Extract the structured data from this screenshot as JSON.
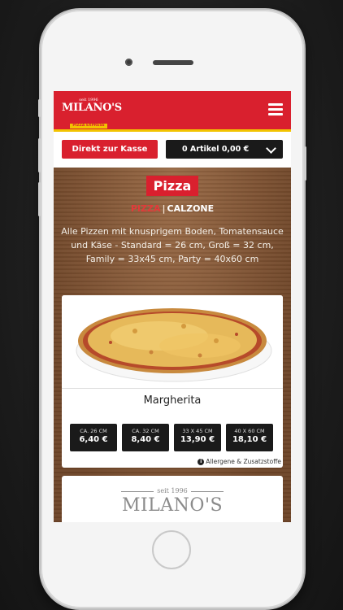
{
  "header": {
    "logo_seit": "seit 1996",
    "logo_name": "MILANO'S",
    "logo_sub": "PIZZA EXPRESS",
    "menu_icon": "hamburger-menu-icon"
  },
  "action_bar": {
    "checkout_label": "Direkt zur Kasse",
    "cart_label": "0 Artikel 0,00 €",
    "cart_icon": "chevron-down-icon"
  },
  "section": {
    "title": "Pizza",
    "categories": [
      {
        "label": "PIZZA",
        "active": true
      },
      {
        "label": "CALZONE",
        "active": false
      }
    ],
    "separator": "|",
    "description": "Alle Pizzen mit knusprigem Boden, Tomatensauce und Käse - Standard = 26 cm, Groß = 32 cm, Family = 33x45 cm, Party = 40x60 cm"
  },
  "products": [
    {
      "name": "Margherita",
      "sizes": [
        {
          "label": "CA. 26 CM",
          "price": "6,40 €"
        },
        {
          "label": "CA. 32 CM",
          "price": "8,40 €"
        },
        {
          "label": "33 X 45 CM",
          "price": "13,90 €"
        },
        {
          "label": "40 X 60 CM",
          "price": "18,10 €"
        }
      ],
      "allergens_label": "Allergene & Zusatzstoffe",
      "allergens_icon": "info-icon"
    }
  ],
  "card2_logo": {
    "seit": "seit 1996",
    "name": "MILANO'S"
  },
  "colors": {
    "brand_red": "#d9202e",
    "brand_yellow": "#f2c300",
    "dark": "#1a1a1a"
  }
}
